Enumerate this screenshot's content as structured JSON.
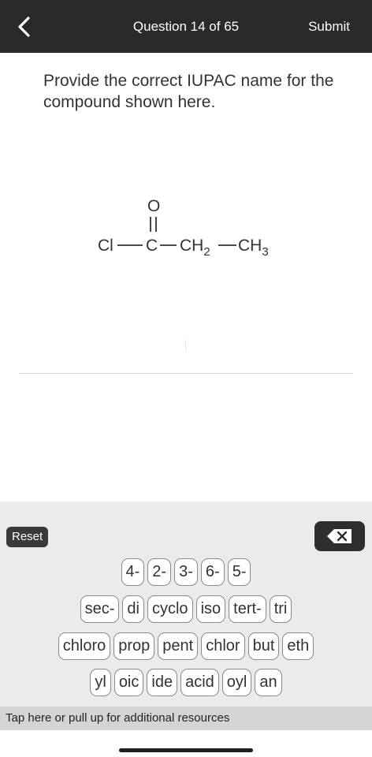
{
  "header": {
    "title": "Question 14 of 65",
    "submit_label": "Submit"
  },
  "question": {
    "text": "Provide the correct IUPAC name for the compound shown here."
  },
  "structure": {
    "oxygen": "O",
    "chlorine": "Cl",
    "carbon": "C",
    "ch2": "CH",
    "ch2_sub": "2",
    "ch3": "CH",
    "ch3_sub": "3"
  },
  "keyboard": {
    "reset_label": "Reset",
    "row1": [
      "4-",
      "2-",
      "3-",
      "6-",
      "5-"
    ],
    "row2": [
      "sec-",
      "di",
      "cyclo",
      "iso",
      "tert-",
      "tri"
    ],
    "row3": [
      "chloro",
      "prop",
      "pent",
      "chlor",
      "but",
      "eth"
    ],
    "row4": [
      "yl",
      "oic",
      "ide",
      "acid",
      "oyl",
      "an"
    ]
  },
  "resources": {
    "text": "Tap here or pull up for additional resources"
  }
}
